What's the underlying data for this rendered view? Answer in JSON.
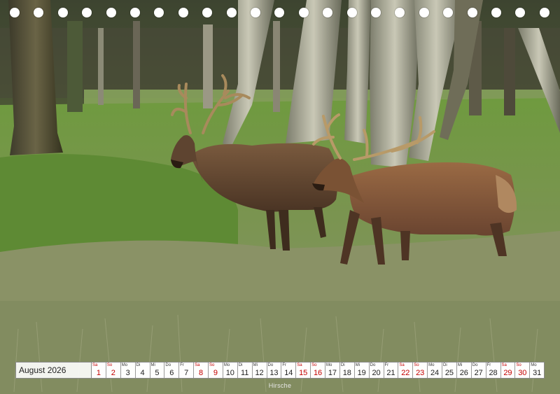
{
  "calendar": {
    "month_label": "August 2026",
    "days": [
      {
        "name": "Sa",
        "num": "1",
        "weekend": true
      },
      {
        "name": "So",
        "num": "2",
        "weekend": true
      },
      {
        "name": "Mo",
        "num": "3",
        "weekend": false
      },
      {
        "name": "Di",
        "num": "4",
        "weekend": false
      },
      {
        "name": "Mi",
        "num": "5",
        "weekend": false
      },
      {
        "name": "Do",
        "num": "6",
        "weekend": false
      },
      {
        "name": "Fr",
        "num": "7",
        "weekend": false
      },
      {
        "name": "Sa",
        "num": "8",
        "weekend": true
      },
      {
        "name": "So",
        "num": "9",
        "weekend": true
      },
      {
        "name": "Mo",
        "num": "10",
        "weekend": false
      },
      {
        "name": "Di",
        "num": "11",
        "weekend": false
      },
      {
        "name": "Mi",
        "num": "12",
        "weekend": false
      },
      {
        "name": "Do",
        "num": "13",
        "weekend": false
      },
      {
        "name": "Fr",
        "num": "14",
        "weekend": false
      },
      {
        "name": "Sa",
        "num": "15",
        "weekend": true
      },
      {
        "name": "So",
        "num": "16",
        "weekend": true
      },
      {
        "name": "Mo",
        "num": "17",
        "weekend": false
      },
      {
        "name": "Di",
        "num": "18",
        "weekend": false
      },
      {
        "name": "Mi",
        "num": "19",
        "weekend": false
      },
      {
        "name": "Do",
        "num": "20",
        "weekend": false
      },
      {
        "name": "Fr",
        "num": "21",
        "weekend": false
      },
      {
        "name": "Sa",
        "num": "22",
        "weekend": true
      },
      {
        "name": "So",
        "num": "23",
        "weekend": true
      },
      {
        "name": "Mo",
        "num": "24",
        "weekend": false
      },
      {
        "name": "Di",
        "num": "25",
        "weekend": false
      },
      {
        "name": "Mi",
        "num": "26",
        "weekend": false
      },
      {
        "name": "Do",
        "num": "27",
        "weekend": false
      },
      {
        "name": "Fr",
        "num": "28",
        "weekend": false
      },
      {
        "name": "Sa",
        "num": "29",
        "weekend": true
      },
      {
        "name": "So",
        "num": "30",
        "weekend": true
      },
      {
        "name": "Mo",
        "num": "31",
        "weekend": false
      }
    ]
  },
  "caption": "Hirsche",
  "colors": {
    "weekend": "#c40000",
    "grass": "#6f8a48",
    "deer_coat": "#6b4a30"
  },
  "binding_hole_count": 23
}
